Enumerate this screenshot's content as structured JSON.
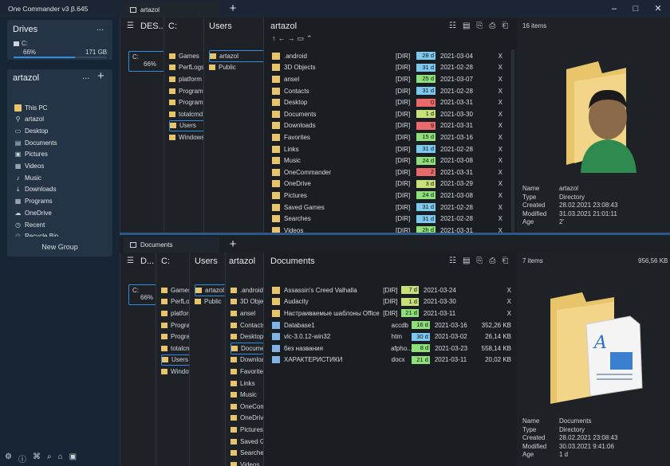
{
  "app": {
    "title": "One Commander v3 β.645",
    "controls": [
      "–",
      "□",
      "✕"
    ]
  },
  "sidebar": {
    "drives": {
      "title": "Drives",
      "more": "...",
      "drive_name": "C:",
      "drive_pct": "66%",
      "drive_size": "171 GB"
    },
    "favorites": {
      "title": "artazol",
      "more": "...",
      "add": "+",
      "items": [
        {
          "label": "This PC",
          "icon": "folder-icon"
        },
        {
          "label": "artazol",
          "icon": "user-icon"
        },
        {
          "label": "Desktop",
          "icon": "desktop-icon"
        },
        {
          "label": "Documents",
          "icon": "document-icon"
        },
        {
          "label": "Pictures",
          "icon": "picture-icon"
        },
        {
          "label": "Videos",
          "icon": "video-icon"
        },
        {
          "label": "Music",
          "icon": "music-icon"
        },
        {
          "label": "Downloads",
          "icon": "download-icon"
        },
        {
          "label": "Programs",
          "icon": "grid-icon"
        },
        {
          "label": "OneDrive",
          "icon": "cloud-icon"
        },
        {
          "label": "Recent",
          "icon": "clock-icon"
        },
        {
          "label": "Recycle Bin",
          "icon": "recycle-icon"
        }
      ]
    },
    "new_group": "New Group"
  },
  "top": {
    "tab_label": "artazol",
    "col_desktop": {
      "title": "DES...",
      "drive": "C:",
      "pct": "66%"
    },
    "col_c": {
      "title": "C:",
      "items": [
        "Games",
        "PerfLogs",
        "platform",
        "Program",
        "Program",
        "totalcmd",
        "Users",
        "Windows"
      ]
    },
    "col_users": {
      "title": "Users",
      "items": [
        "artazol",
        "Public"
      ]
    },
    "main_title": "artazol",
    "count": "16 items",
    "rows": [
      {
        "name": ".android",
        "type": "[DIR]",
        "bar": "28 d",
        "color": "#7ec9f0",
        "date": "2021-03-04",
        "x": "X"
      },
      {
        "name": "3D Objects",
        "type": "[DIR]",
        "bar": "31 d",
        "color": "#7ec9f0",
        "date": "2021-02-28",
        "x": "X"
      },
      {
        "name": "ansel",
        "type": "[DIR]",
        "bar": "25 d",
        "color": "#8fe07a",
        "date": "2021-03-07",
        "x": "X"
      },
      {
        "name": "Contacts",
        "type": "[DIR]",
        "bar": "31 d",
        "color": "#7ec9f0",
        "date": "2021-02-28",
        "x": "X"
      },
      {
        "name": "Desktop",
        "type": "[DIR]",
        "bar": "0",
        "color": "#e86a6a",
        "date": "2021-03-31",
        "x": "X"
      },
      {
        "name": "Documents",
        "type": "[DIR]",
        "bar": "1 d",
        "color": "#c8e07a",
        "date": "2021-03-30",
        "x": "X"
      },
      {
        "name": "Downloads",
        "type": "[DIR]",
        "bar": "9",
        "color": "#e86a6a",
        "date": "2021-03-31",
        "x": "X"
      },
      {
        "name": "Favorites",
        "type": "[DIR]",
        "bar": "15 d",
        "color": "#8fe07a",
        "date": "2021-03-16",
        "x": "X"
      },
      {
        "name": "Links",
        "type": "[DIR]",
        "bar": "31 d",
        "color": "#7ec9f0",
        "date": "2021-02-28",
        "x": "X"
      },
      {
        "name": "Music",
        "type": "[DIR]",
        "bar": "24 d",
        "color": "#8fe07a",
        "date": "2021-03-08",
        "x": "X"
      },
      {
        "name": "OneCommander",
        "type": "[DIR]",
        "bar": "2",
        "color": "#e86a6a",
        "date": "2021-03-31",
        "x": "X"
      },
      {
        "name": "OneDrive",
        "type": "[DIR]",
        "bar": "3 d",
        "color": "#c8e07a",
        "date": "2021-03-29",
        "x": "X"
      },
      {
        "name": "Pictures",
        "type": "[DIR]",
        "bar": "24 d",
        "color": "#8fe07a",
        "date": "2021-03-08",
        "x": "X"
      },
      {
        "name": "Saved Games",
        "type": "[DIR]",
        "bar": "31 d",
        "color": "#7ec9f0",
        "date": "2021-02-28",
        "x": "X"
      },
      {
        "name": "Searches",
        "type": "[DIR]",
        "bar": "31 d",
        "color": "#7ec9f0",
        "date": "2021-02-28",
        "x": "X"
      },
      {
        "name": "Videos",
        "type": "[DIR]",
        "bar": "2h d",
        "color": "#8fe07a",
        "date": "2021-03-31",
        "x": "X"
      }
    ],
    "info": {
      "k1": "Name",
      "v1": "artazol",
      "k2": "Type",
      "v2": "Directory",
      "k3": "Created",
      "v3": "28.02.2021 23:08:43",
      "k4": "Modified",
      "v4": "31.03.2021 21:01:11",
      "k5": "Age",
      "v5": "2'"
    }
  },
  "bottom": {
    "tab_label": "Documents",
    "col_d": {
      "title": "D...",
      "drive": "C:",
      "pct": "66%"
    },
    "col_c": {
      "title": "C:",
      "items": [
        "Games",
        "PerfLogs",
        "platform",
        "Program",
        "Program",
        "totalcmd",
        "Users",
        "Windows"
      ]
    },
    "col_users": {
      "title": "Users",
      "items": [
        "artazol",
        "Public"
      ]
    },
    "col_artazol": {
      "title": "artazol",
      "items": [
        ".android",
        "3D Objects",
        "ansel",
        "Contacts",
        "Desktop",
        "Documents",
        "Downloads",
        "Favorites",
        "Links",
        "Music",
        "OneCommander",
        "OneDrive",
        "Pictures",
        "Saved Games",
        "Searches",
        "Videos"
      ]
    },
    "main_title": "Documents",
    "count": "7 items",
    "total": "956,56 KB",
    "rows": [
      {
        "name": "Assassin's Creed Valhalla",
        "type": "[DIR]",
        "bar": "7 d",
        "color": "#c8e07a",
        "date": "2021-03-24",
        "size": "",
        "x": "X"
      },
      {
        "name": "Audacity",
        "type": "[DIR]",
        "bar": "1 d",
        "color": "#c8e07a",
        "date": "2021-03-30",
        "size": "",
        "x": "X"
      },
      {
        "name": "Настраиваемые шаблоны Office",
        "type": "[DIR]",
        "bar": "21 d",
        "color": "#8fe07a",
        "date": "2021-03-11",
        "size": "",
        "x": "X"
      },
      {
        "name": "Database1",
        "type": "accdb",
        "bar": "16 d",
        "color": "#8fe07a",
        "date": "2021-03-16",
        "size": "352,26 KB",
        "x": ""
      },
      {
        "name": "vlc-3.0.12-win32",
        "type": "htm",
        "bar": "30 d",
        "color": "#7ec9f0",
        "date": "2021-03-02",
        "size": "26,14 KB",
        "x": ""
      },
      {
        "name": "без названия",
        "type": "afpho...",
        "bar": "8 d",
        "color": "#8fe07a",
        "date": "2021-03-23",
        "size": "558,14 KB",
        "x": ""
      },
      {
        "name": "ХАРАКТЕРИСТИКИ",
        "type": "docx",
        "bar": "21 d",
        "color": "#8fe07a",
        "date": "2021-03-11",
        "size": "20,02 KB",
        "x": ""
      }
    ],
    "info": {
      "k1": "Name",
      "v1": "Documents",
      "k2": "Type",
      "v2": "Directory",
      "k3": "Created",
      "v3": "28.02.2021 23:08:43",
      "k4": "Modified",
      "v4": "30.03.2021 9:41:06",
      "k5": "Age",
      "v5": "1 d"
    }
  }
}
